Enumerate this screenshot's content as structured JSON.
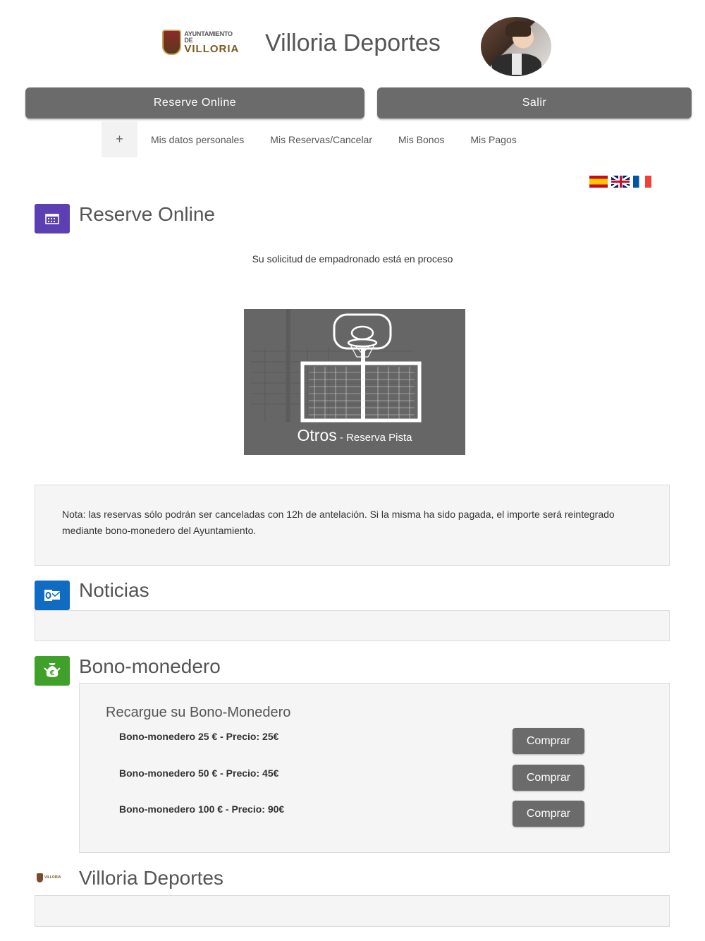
{
  "header": {
    "logo_line1": "AYUNTAMIENTO DE",
    "logo_line2": "VILLORIA",
    "title": "Villoria Deportes"
  },
  "top_buttons": {
    "reserve": "Reserve Online",
    "salir": "Salir"
  },
  "subnav": {
    "expand_symbol": "+",
    "items": [
      "Mis datos personales",
      "Mis Reservas/Cancelar",
      "Mis Bonos",
      "Mis Pagos"
    ]
  },
  "languages": [
    "es",
    "en",
    "fr"
  ],
  "reserve_section": {
    "title": "Reserve Online",
    "icon": "calendar-icon",
    "icon_color": "#5b3fb3",
    "notice": "Su solicitud de empadronado está en proceso",
    "card": {
      "main": "Otros",
      "sub": " - Reserva Pista"
    }
  },
  "nota": "Nota: las reservas sólo podrán ser canceladas con 12h de antelación. Si la misma ha sido pagada, el importe será reintegrado mediante bono-monedero del Ayuntamiento.",
  "news_section": {
    "title": "Noticias",
    "icon": "outlook-icon",
    "icon_color": "#0f6cc2"
  },
  "bono_section": {
    "title": "Bono-monedero",
    "icon": "money-bag-icon",
    "icon_color": "#3fa02a",
    "heading": "Recargue su Bono-Monedero",
    "items": [
      {
        "label": "Bono-monedero 25 € - Precio: 25€",
        "button": "Comprar"
      },
      {
        "label": "Bono-monedero 50 € - Precio: 45€",
        "button": "Comprar"
      },
      {
        "label": "Bono-monedero 100 € - Precio: 90€",
        "button": "Comprar"
      }
    ]
  },
  "footer_section": {
    "title": "Villoria Deportes"
  }
}
